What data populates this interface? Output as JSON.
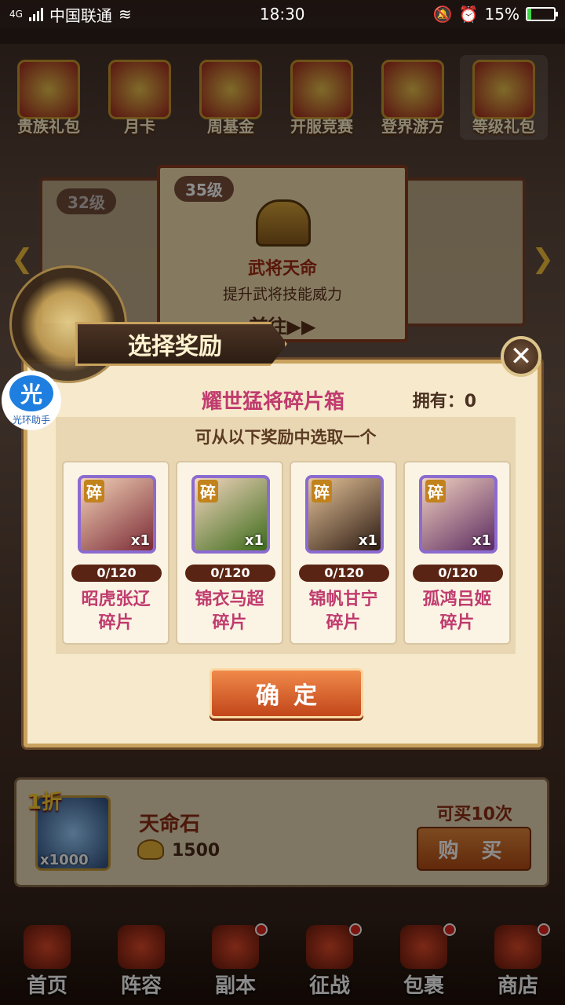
{
  "status_bar": {
    "network": "4G",
    "carrier": "中国联通",
    "time": "18:30",
    "battery_percent": "15%",
    "battery_level": 0.15
  },
  "background": {
    "events": [
      {
        "label": "贵族礼包",
        "icon": "noble-gift-icon"
      },
      {
        "label": "月卡",
        "icon": "monthly-card-icon"
      },
      {
        "label": "周基金",
        "icon": "weekly-fund-icon"
      },
      {
        "label": "开服竞赛",
        "icon": "server-race-icon"
      },
      {
        "label": "登界游方",
        "icon": "travel-icon"
      },
      {
        "label": "等级礼包",
        "icon": "level-gift-icon"
      }
    ],
    "scroll": {
      "level": "35级",
      "title": "武将天命",
      "desc": "提升武将技能威力",
      "go": "前往▶▶"
    },
    "side_level": "32级",
    "shop_item": {
      "discount": "1折",
      "name": "天命石",
      "count": "x1000",
      "price": "1500",
      "limit": "可买10次",
      "buy_label": "购 买"
    },
    "nav": [
      {
        "label": "首页",
        "dot": false
      },
      {
        "label": "阵容",
        "dot": false
      },
      {
        "label": "副本",
        "dot": true
      },
      {
        "label": "征战",
        "dot": true
      },
      {
        "label": "包裹",
        "dot": true
      },
      {
        "label": "商店",
        "dot": true
      }
    ]
  },
  "helper": {
    "logo": "光",
    "text": "光环助手"
  },
  "modal": {
    "title": "选择奖励",
    "close": "✕",
    "box_name": "耀世猛将碎片箱",
    "owned": "拥有：0",
    "hint": "可从以下奖励中选取一个",
    "cards": [
      {
        "badge": "碎",
        "qty": "x1",
        "progress": "0/120",
        "name": "昭虎张辽",
        "suffix": "碎片"
      },
      {
        "badge": "碎",
        "qty": "x1",
        "progress": "0/120",
        "name": "锦衣马超",
        "suffix": "碎片"
      },
      {
        "badge": "碎",
        "qty": "x1",
        "progress": "0/120",
        "name": "锦帆甘宁",
        "suffix": "碎片"
      },
      {
        "badge": "碎",
        "qty": "x1",
        "progress": "0/120",
        "name": "孤鸿吕姬",
        "suffix": "碎片"
      }
    ],
    "confirm": "确定"
  }
}
